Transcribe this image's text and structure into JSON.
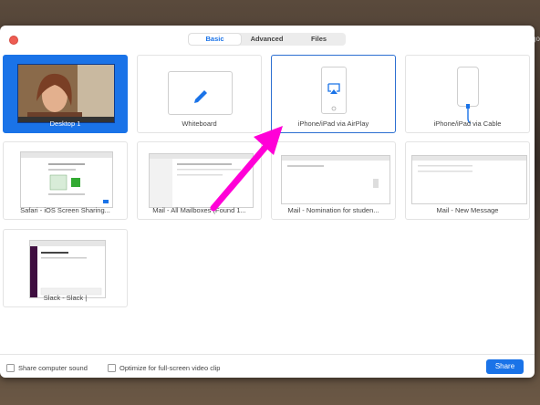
{
  "tabs": [
    {
      "label": "Basic",
      "active": true
    },
    {
      "label": "Advanced",
      "active": false
    },
    {
      "label": "Files",
      "active": false
    }
  ],
  "tiles": [
    {
      "label": "Desktop 1",
      "selected": true
    },
    {
      "label": "Whiteboard",
      "icon": "pencil-icon"
    },
    {
      "label": "iPhone/iPad via AirPlay",
      "icon": "airplay-device-icon"
    },
    {
      "label": "iPhone/iPad via Cable",
      "icon": "cable-device-icon"
    },
    {
      "label": "Safari - iOS Screen Sharing..."
    },
    {
      "label": "Mail - All Mailboxes (Found 1..."
    },
    {
      "label": "Mail - Nomination for studen..."
    },
    {
      "label": "Mail - New Message"
    },
    {
      "label": "Slack - Slack |"
    }
  ],
  "footer": {
    "share_sound": "Share computer sound",
    "optimize_video": "Optimize for full-screen video clip",
    "share_button": "Share"
  },
  "edge_text": "go",
  "colors": {
    "accent": "#1a73e8",
    "annotation_arrow": "#ff00d7"
  }
}
